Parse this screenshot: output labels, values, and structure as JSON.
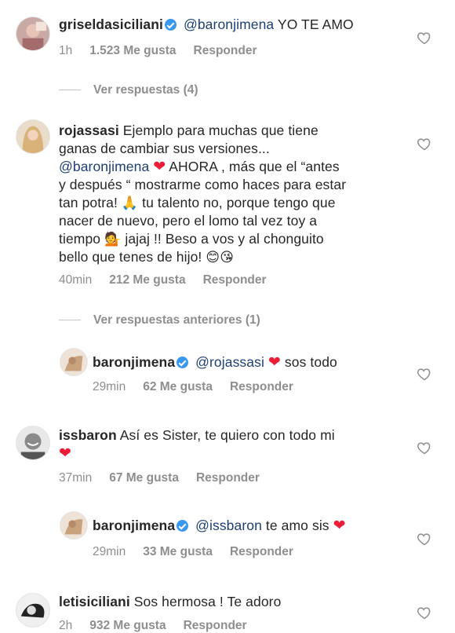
{
  "comments": [
    {
      "username": "griseldasiciliani",
      "mention": "@baronjimena",
      "text": "YO TE AMO",
      "time": "1h",
      "likes": "1.523 Me gusta",
      "reply": "Responder",
      "view_replies": "Ver respuestas (4)"
    },
    {
      "username": "rojassasi",
      "line1": "Ejemplo para muchas que tiene",
      "line2": "ganas de cambiar sus versiones...",
      "mention": "@baronjimena",
      "line3_rest": "AHORA , más que el “antes",
      "line4": "y después “ mostrarme como haces para estar",
      "line5a": "tan potra!",
      "line5b": "tu talento no, porque tengo que",
      "line6": "nacer de nuevo, pero el lomo tal vez toy a",
      "line7a": "tiempo",
      "line7b": "jajaj !! Beso a vos y al chonguito",
      "line8": "bello que tenes de hijo!",
      "time": "40min",
      "likes": "212 Me gusta",
      "reply": "Responder",
      "view_replies": "Ver respuestas anteriores (1)"
    },
    {
      "username": "baronjimena",
      "mention": "@rojassasi",
      "text": "sos todo",
      "time": "29min",
      "likes": "62 Me gusta",
      "reply": "Responder"
    },
    {
      "username": "issbaron",
      "text": "Así es Sister, te quiero con todo mi",
      "time": "37min",
      "likes": "67 Me gusta",
      "reply": "Responder"
    },
    {
      "username": "baronjimena",
      "mention": "@issbaron",
      "text": "te amo sis",
      "time": "29min",
      "likes": "33 Me gusta",
      "reply": "Responder"
    },
    {
      "username": "letisiciliani",
      "text": "Sos hermosa ! Te adoro",
      "time": "2h",
      "likes": "932 Me gusta",
      "reply": "Responder"
    }
  ],
  "colors": {
    "heart": "#ed1c39",
    "verified": "#3897f0",
    "mention": "#1d3f72",
    "meta": "#8e8e8e"
  }
}
